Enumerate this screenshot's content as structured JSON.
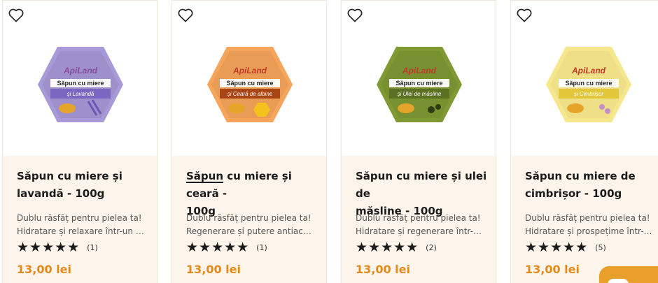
{
  "products": [
    {
      "title": "Săpun cu miere și lavandă - 100g",
      "title_lines": [
        "Săpun cu miere și",
        "lavandă - 100g"
      ],
      "description": [
        "Dublu răsfăț pentru pielea ta!",
        "Hidratare și relaxare într-un singur săpun"
      ],
      "rating_stars": 5,
      "review_count": "(1)",
      "price": "13,00 lei",
      "soap_color": "#a79ad8",
      "soap_band_color": "#7a67c1",
      "brand": "ApiLand",
      "label": "Săpun cu miere",
      "variant": "și Lavandă",
      "wishlist_icon": "heart-outline-icon"
    },
    {
      "title": "Săpun cu miere și ceară - 100g",
      "title_lines": [
        "Săpun cu miere și ceară -",
        "100g"
      ],
      "description": [
        "Dublu răsfăț pentru pielea ta!",
        "Regenerare și putere antiacneică"
      ],
      "rating_stars": 5,
      "review_count": "(1)",
      "price": "13,00 lei",
      "soap_color": "#f6a55a",
      "soap_band_color": "#a94413",
      "brand": "ApiLand",
      "label": "Săpun cu miere",
      "variant": "și Ceară de albine",
      "wishlist_icon": "heart-outline-icon"
    },
    {
      "title": "Săpun cu miere și ulei de măsline - 100g",
      "title_lines": [
        "Săpun cu miere și ulei de",
        "măsline - 100g"
      ],
      "description": [
        "Dublu răsfăț pentru pielea ta!",
        "Hidratare și regenerare într-un săpun"
      ],
      "rating_stars": 5,
      "review_count": "(2)",
      "price": "13,00 lei",
      "soap_color": "#7f9a34",
      "soap_band_color": "#5b7020",
      "brand": "ApiLand",
      "label": "Săpun cu miere",
      "variant": "și Ulei de măsline",
      "wishlist_icon": "heart-outline-icon"
    },
    {
      "title": "Săpun cu miere de cimbrișor - 100g",
      "title_lines": [
        "Săpun cu miere de",
        "cimbrișor - 100g"
      ],
      "description": [
        "Dublu răsfăț pentru pielea ta!",
        "Hidratare și prospețime într-un săpun"
      ],
      "rating_stars": 5,
      "review_count": "(5)",
      "price": "13,00 lei",
      "soap_color": "#f7e78c",
      "soap_band_color": "#e2c73a",
      "brand": "ApiLand",
      "label": "Săpun cu miere",
      "variant": "și Cimbrișor",
      "wishlist_icon": "heart-outline-icon"
    }
  ],
  "stars_text": "★★★★★",
  "accent_color": "#e38a1c",
  "chat_widget_icon": "chat-icon"
}
